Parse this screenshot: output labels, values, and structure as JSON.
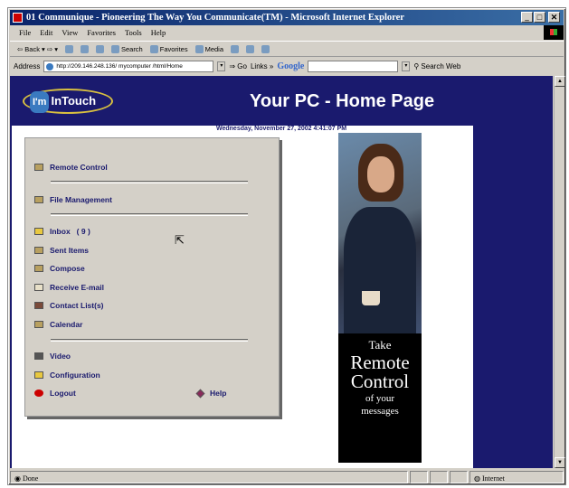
{
  "window": {
    "title": "01 Communique - Pioneering The Way You Communicate(TM) - Microsoft Internet Explorer",
    "buttons": [
      "_",
      "□",
      "✕"
    ]
  },
  "menu": [
    "File",
    "Edit",
    "View",
    "Favorites",
    "Tools",
    "Help"
  ],
  "toolbar": {
    "back": "Back",
    "search": "Search",
    "favorites": "Favorites",
    "media": "Media"
  },
  "address": {
    "label": "Address",
    "url": "http://209.146.248.136/ mycomputer /html/Home",
    "go": "Go",
    "links": "Links",
    "google": "Google",
    "search_web": "Search Web"
  },
  "page": {
    "brand": "InTouch",
    "brand_mark": "I'm",
    "title": "Your PC - Home Page",
    "date": "Wednesday, November 27, 2002 4:41:07 PM"
  },
  "menu_items": {
    "remote": "Remote Control",
    "files": "File Management",
    "inbox": "Inbox",
    "inbox_count": "( 9 )",
    "sent": "Sent Items",
    "compose": "Compose",
    "receive": "Receive E-mail",
    "contacts": "Contact List(s)",
    "calendar": "Calendar",
    "video": "Video",
    "config": "Configuration",
    "logout": "Logout",
    "help": "Help"
  },
  "ad": {
    "line1": "Take",
    "line2": "Remote",
    "line3": "Control",
    "line4": "of your",
    "line5": "messages"
  },
  "status": {
    "text": "Done",
    "zone": "Internet"
  }
}
